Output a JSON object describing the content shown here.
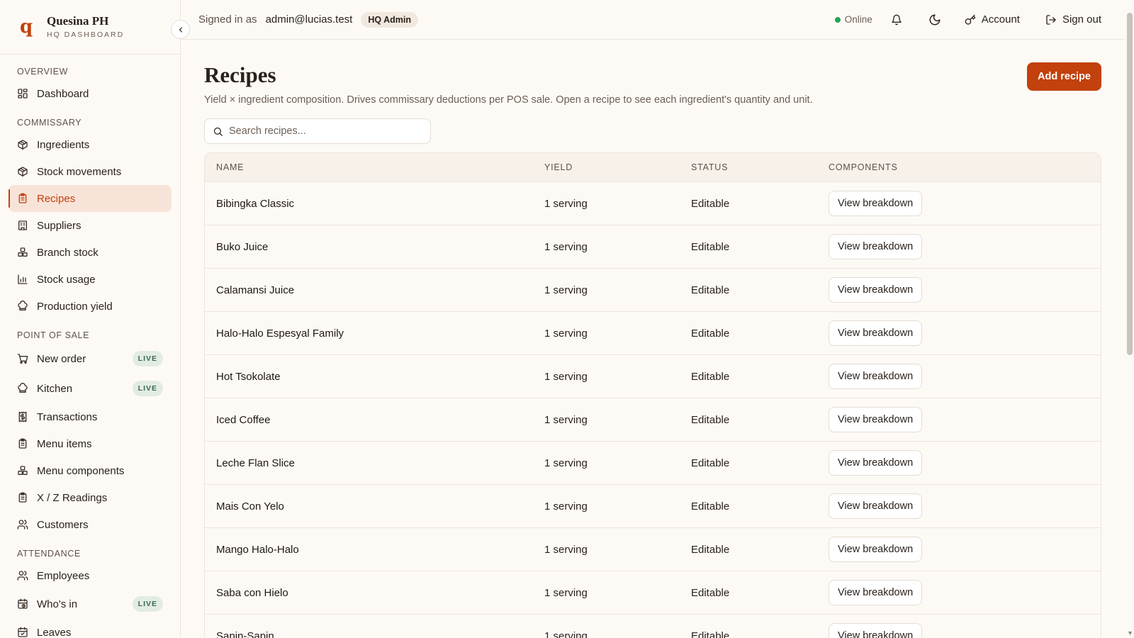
{
  "brand": {
    "logo": "q",
    "name": "Quesina PH",
    "subtitle": "HQ DASHBOARD"
  },
  "sidebar": {
    "sections": [
      {
        "title": "OVERVIEW",
        "items": [
          {
            "label": "Dashboard",
            "icon": "grid-icon"
          }
        ]
      },
      {
        "title": "COMMISSARY",
        "items": [
          {
            "label": "Ingredients",
            "icon": "box-icon"
          },
          {
            "label": "Stock movements",
            "icon": "box-icon"
          },
          {
            "label": "Recipes",
            "icon": "clipboard-icon",
            "active": true
          },
          {
            "label": "Suppliers",
            "icon": "building-icon"
          },
          {
            "label": "Branch stock",
            "icon": "boxes-icon"
          },
          {
            "label": "Stock usage",
            "icon": "chart-icon"
          },
          {
            "label": "Production yield",
            "icon": "chef-hat-icon"
          }
        ]
      },
      {
        "title": "POINT OF SALE",
        "items": [
          {
            "label": "New order",
            "icon": "cart-icon",
            "badge": "LIVE"
          },
          {
            "label": "Kitchen",
            "icon": "chef-hat-icon",
            "badge": "LIVE"
          },
          {
            "label": "Transactions",
            "icon": "receipt-icon"
          },
          {
            "label": "Menu items",
            "icon": "clipboard-icon"
          },
          {
            "label": "Menu components",
            "icon": "boxes-icon"
          },
          {
            "label": "X / Z Readings",
            "icon": "clipboard-icon"
          },
          {
            "label": "Customers",
            "icon": "users-icon"
          }
        ]
      },
      {
        "title": "ATTENDANCE",
        "items": [
          {
            "label": "Employees",
            "icon": "users-icon"
          },
          {
            "label": "Who's in",
            "icon": "calendar-clock-icon",
            "badge": "LIVE"
          },
          {
            "label": "Leaves",
            "icon": "calendar-icon"
          }
        ]
      }
    ]
  },
  "topbar": {
    "signed_label": "Signed in as",
    "email": "admin@lucias.test",
    "role": "HQ Admin",
    "status": "Online",
    "status_color": "#22a35a",
    "account_label": "Account",
    "signout_label": "Sign out"
  },
  "page": {
    "title": "Recipes",
    "description": "Yield × ingredient composition. Drives commissary deductions per POS sale. Open a recipe to see each ingredient's quantity and unit.",
    "add_label": "Add recipe",
    "search_placeholder": "Search recipes..."
  },
  "table": {
    "columns": [
      "NAME",
      "YIELD",
      "STATUS",
      "COMPONENTS"
    ],
    "action_label": "View breakdown",
    "rows": [
      {
        "name": "Bibingka Classic",
        "yield": "1 serving",
        "status": "Editable"
      },
      {
        "name": "Buko Juice",
        "yield": "1 serving",
        "status": "Editable"
      },
      {
        "name": "Calamansi Juice",
        "yield": "1 serving",
        "status": "Editable"
      },
      {
        "name": "Halo-Halo Espesyal Family",
        "yield": "1 serving",
        "status": "Editable"
      },
      {
        "name": "Hot Tsokolate",
        "yield": "1 serving",
        "status": "Editable"
      },
      {
        "name": "Iced Coffee",
        "yield": "1 serving",
        "status": "Editable"
      },
      {
        "name": "Leche Flan Slice",
        "yield": "1 serving",
        "status": "Editable"
      },
      {
        "name": "Mais Con Yelo",
        "yield": "1 serving",
        "status": "Editable"
      },
      {
        "name": "Mango Halo-Halo",
        "yield": "1 serving",
        "status": "Editable"
      },
      {
        "name": "Saba con Hielo",
        "yield": "1 serving",
        "status": "Editable"
      },
      {
        "name": "Sapin-Sapin",
        "yield": "1 serving",
        "status": "Editable"
      }
    ]
  },
  "colors": {
    "accent": "#c2410c",
    "background": "#fdfaf6",
    "active_bg": "#f8e3d8"
  }
}
